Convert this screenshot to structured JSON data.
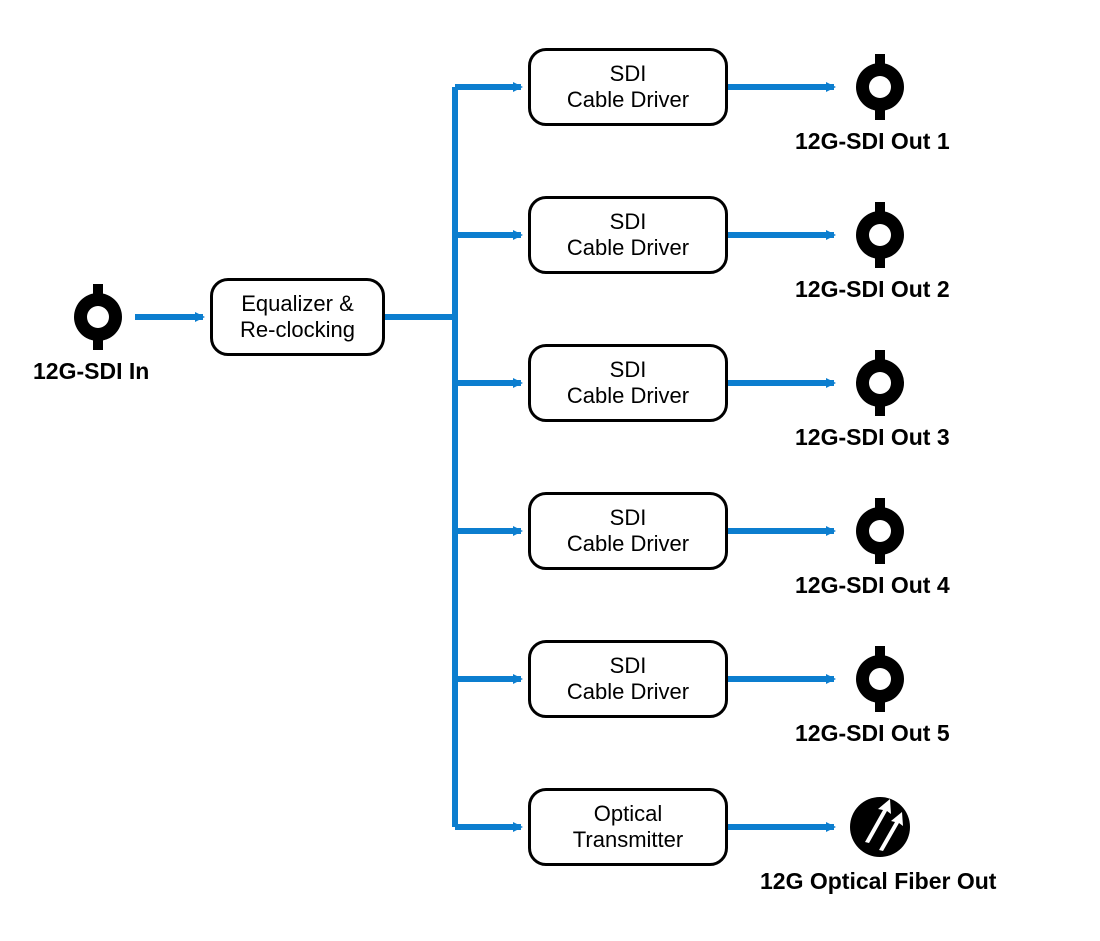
{
  "diagram": {
    "type": "signal-flow",
    "input": {
      "label": "12G-SDI In",
      "icon": "bnc-connector"
    },
    "equalizer": {
      "line1": "Equalizer &",
      "line2": "Re-clocking"
    },
    "branches": [
      {
        "box": {
          "line1": "SDI",
          "line2": "Cable Driver"
        },
        "out_label": "12G-SDI Out 1",
        "out_icon": "bnc-connector"
      },
      {
        "box": {
          "line1": "SDI",
          "line2": "Cable Driver"
        },
        "out_label": "12G-SDI Out 2",
        "out_icon": "bnc-connector"
      },
      {
        "box": {
          "line1": "SDI",
          "line2": "Cable Driver"
        },
        "out_label": "12G-SDI Out 3",
        "out_icon": "bnc-connector"
      },
      {
        "box": {
          "line1": "SDI",
          "line2": "Cable Driver"
        },
        "out_label": "12G-SDI Out 4",
        "out_icon": "bnc-connector"
      },
      {
        "box": {
          "line1": "SDI",
          "line2": "Cable Driver"
        },
        "out_label": "12G-SDI Out 5",
        "out_icon": "bnc-connector"
      },
      {
        "box": {
          "line1": "Optical",
          "line2": "Transmitter"
        },
        "out_label": "12G Optical Fiber Out",
        "out_icon": "optical-connector"
      }
    ]
  },
  "style": {
    "arrow_color": "#0c7ecf",
    "node_border": "#000000",
    "text_color": "#000000"
  }
}
